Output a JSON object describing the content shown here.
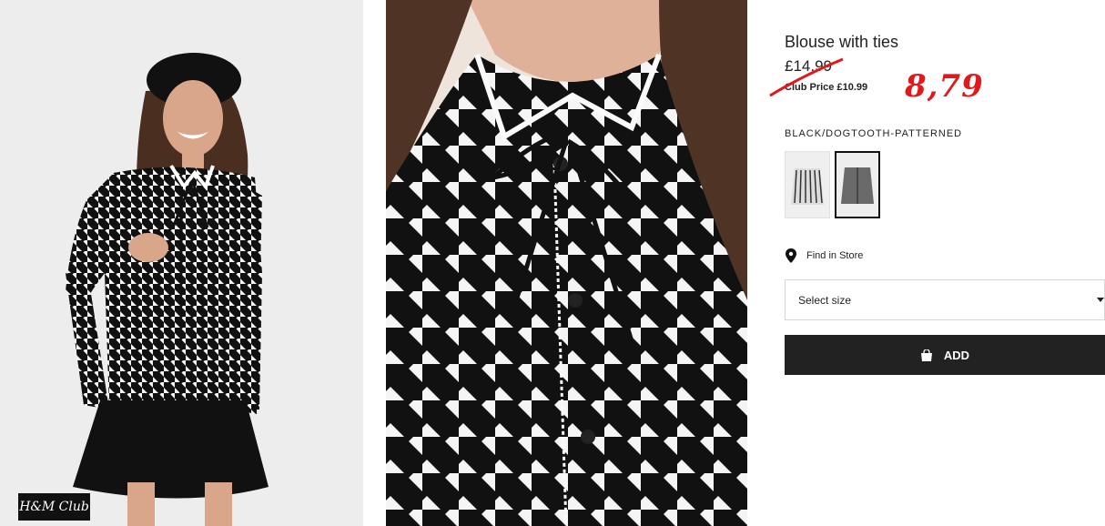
{
  "product": {
    "title": "Blouse with ties",
    "price_old": "£14.99",
    "club_price": "Club Price £10.99",
    "handwritten_price": "8,79",
    "handwritten_color": "#e0191c",
    "color_label": "BLACK/DOGTOOTH-PATTERNED"
  },
  "store": {
    "find_label": "Find in Store"
  },
  "size": {
    "placeholder": "Select size"
  },
  "add": {
    "label": "ADD"
  },
  "brand": {
    "club_logo": "H&M Club"
  }
}
